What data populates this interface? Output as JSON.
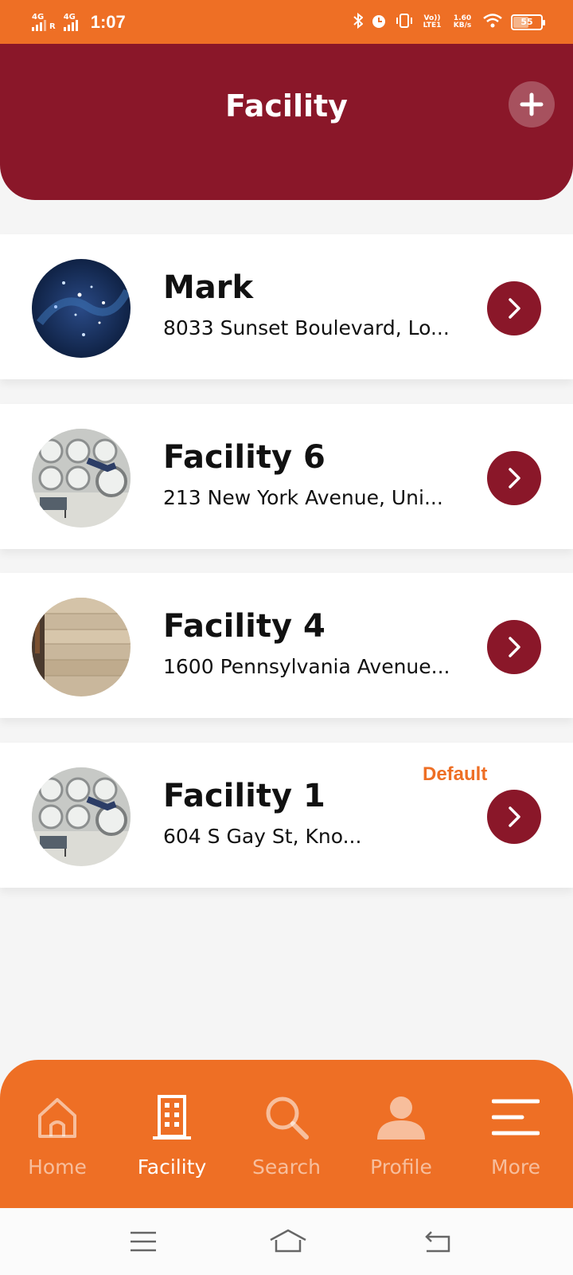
{
  "status_bar": {
    "network_1": "4G",
    "roaming": "R",
    "network_2": "4G",
    "time": "1:07",
    "volte": "Vo)) LTE1",
    "speed": "1.60 KB/s",
    "battery": "55",
    "battery_level": 0.55
  },
  "header": {
    "title": "Facility",
    "add_icon": "plus-icon",
    "color": "#8a1729"
  },
  "facilities": [
    {
      "name": "Mark",
      "address": "8033 Sunset Boulevard, Lo...",
      "image": "starry-abstract",
      "default": ""
    },
    {
      "name": "Facility 6",
      "address": "213 New York Avenue, Uni...",
      "image": "laundromat",
      "default": ""
    },
    {
      "name": "Facility 4",
      "address": "1600 Pennsylvania Avenue...",
      "image": "wood-planks",
      "default": ""
    },
    {
      "name": "Facility 1",
      "address": "604 S Gay St, Kno...",
      "image": "laundromat",
      "default": "Default"
    }
  ],
  "bottom_nav": {
    "items": [
      {
        "label": "Home",
        "icon": "home-icon"
      },
      {
        "label": "Facility",
        "icon": "building-icon"
      },
      {
        "label": "Search",
        "icon": "search-icon"
      },
      {
        "label": "Profile",
        "icon": "profile-icon"
      },
      {
        "label": "More",
        "icon": "menu-icon"
      }
    ],
    "active": "Facility",
    "color": "#ee6f25"
  },
  "system_nav": [
    "menu-icon",
    "home-icon",
    "back-icon"
  ]
}
